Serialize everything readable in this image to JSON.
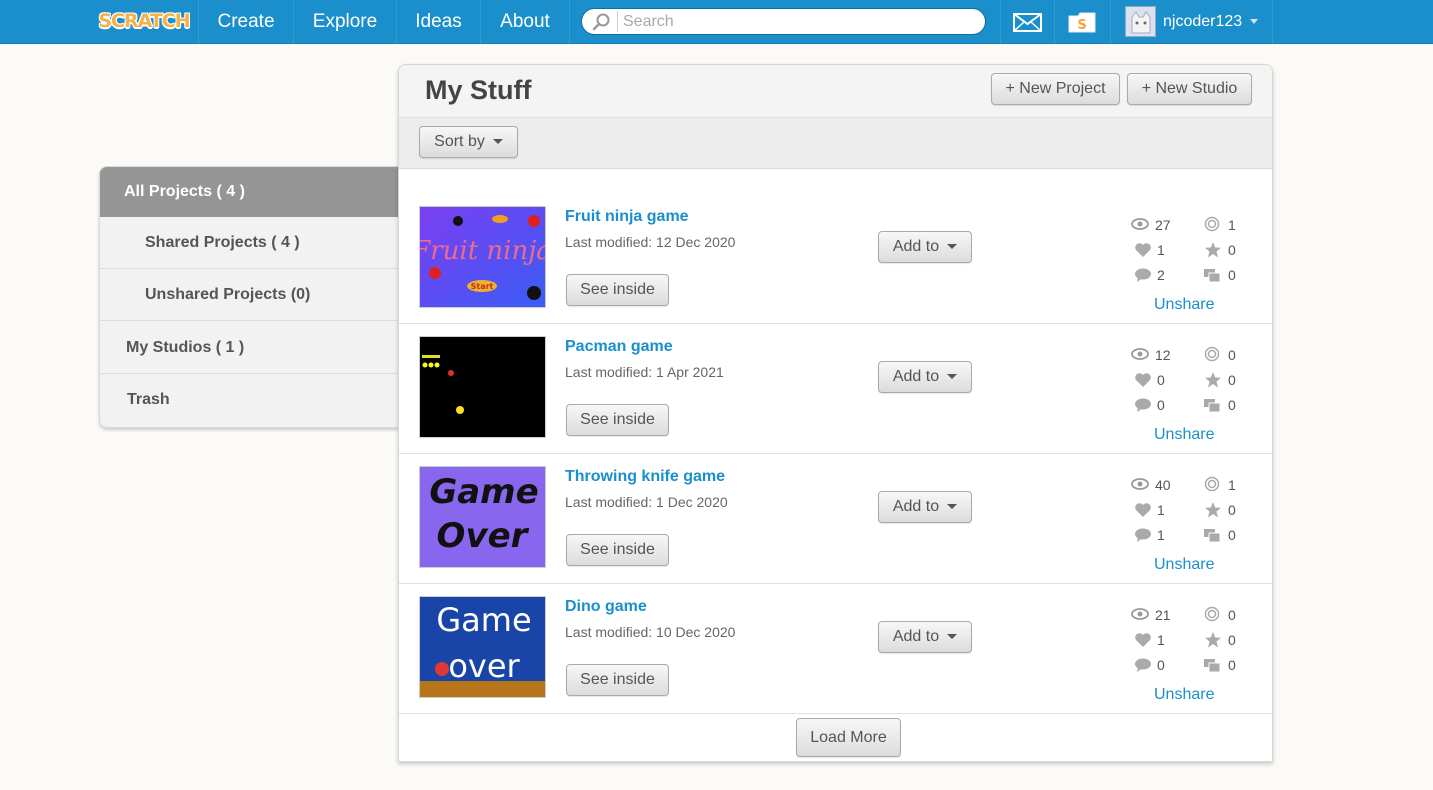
{
  "nav": {
    "logo": "SCRATCH",
    "links": [
      "Create",
      "Explore",
      "Ideas",
      "About"
    ],
    "search_placeholder": "Search",
    "username": "njcoder123"
  },
  "sidebar": {
    "items": [
      {
        "label": "All Projects ( 4 )",
        "active": true,
        "indent": false
      },
      {
        "label": "Shared Projects ( 4 )",
        "active": false,
        "indent": true
      },
      {
        "label": "Unshared Projects (0)",
        "active": false,
        "indent": true
      },
      {
        "label": "My Studios ( 1 )",
        "active": false,
        "indent": false
      },
      {
        "label": "Trash",
        "active": false,
        "indent": false
      }
    ]
  },
  "main": {
    "title": "My Stuff",
    "new_project": "+ New Project",
    "new_studio": "+ New Studio",
    "sort_by": "Sort by",
    "load_more": "Load More",
    "see_inside": "See inside",
    "add_to": "Add to",
    "unshare": "Unshare",
    "projects": [
      {
        "title": "Fruit ninja game",
        "modified": "Last modified: 12 Dec 2020",
        "views": "27",
        "remixes": "1",
        "loves": "1",
        "favorites": "0",
        "comments": "2",
        "studios": "0",
        "thumb_text": [
          "Fruit ninja",
          "Start"
        ]
      },
      {
        "title": "Pacman game",
        "modified": "Last modified: 1 Apr 2021",
        "views": "12",
        "remixes": "0",
        "loves": "0",
        "favorites": "0",
        "comments": "0",
        "studios": "0",
        "thumb_text": []
      },
      {
        "title": "Throwing knife game",
        "modified": "Last modified: 1 Dec 2020",
        "views": "40",
        "remixes": "1",
        "loves": "1",
        "favorites": "0",
        "comments": "1",
        "studios": "0",
        "thumb_text": [
          "Game",
          "Over"
        ]
      },
      {
        "title": "Dino game",
        "modified": "Last modified: 10 Dec 2020",
        "views": "21",
        "remixes": "0",
        "loves": "1",
        "favorites": "0",
        "comments": "0",
        "studios": "0",
        "thumb_text": [
          "Game",
          "over"
        ]
      }
    ]
  },
  "colors": {
    "nav_bg": "#1a8fcb",
    "link": "#1a8fcb",
    "sidebar_active": "#959595"
  },
  "icons": [
    "search-icon",
    "messages-icon",
    "my-stuff-icon",
    "views-icon",
    "remix-icon",
    "love-icon",
    "favorite-icon",
    "comment-icon",
    "studio-icon"
  ]
}
